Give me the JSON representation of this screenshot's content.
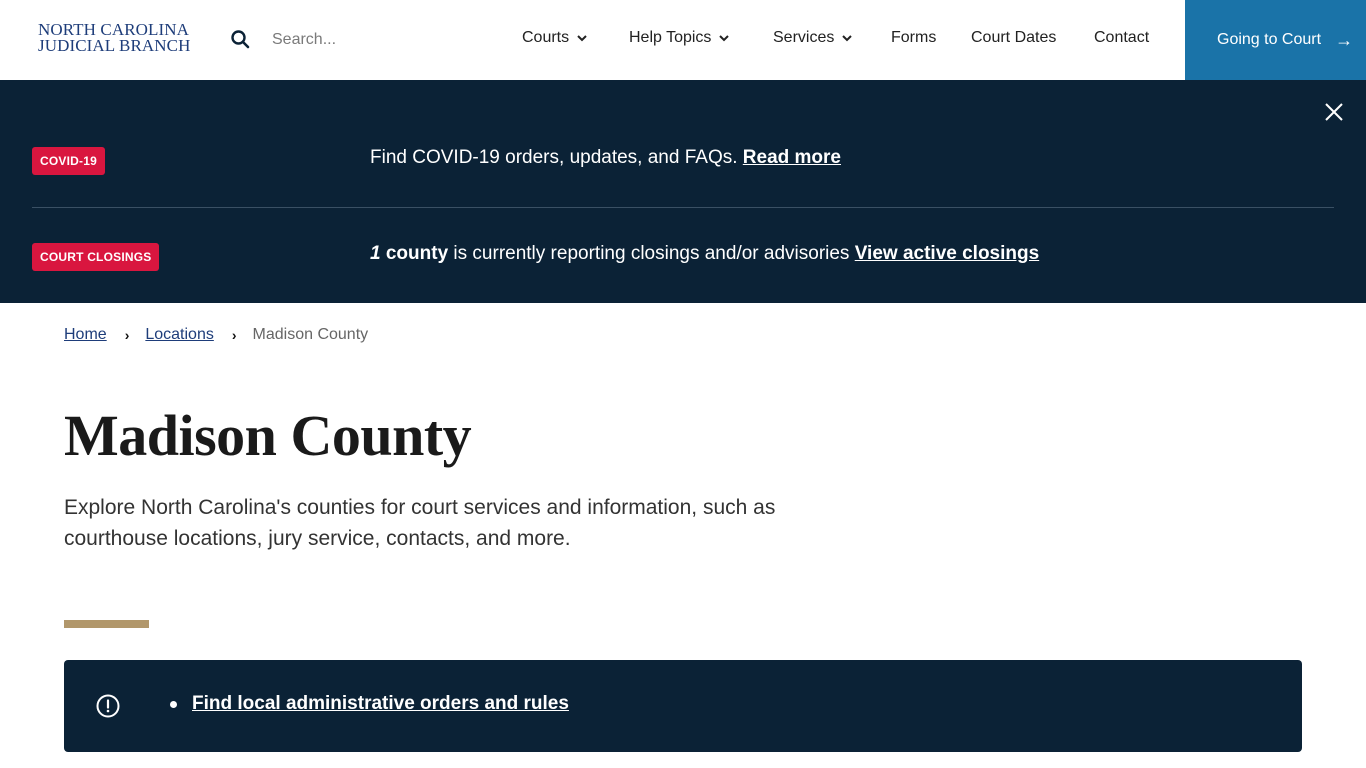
{
  "header": {
    "logo_line1": "NORTH CAROLINA",
    "logo_line2": "JUDICIAL BRANCH",
    "search": {
      "placeholder": "Search...",
      "value": "",
      "icon": "search-icon"
    },
    "nav": [
      {
        "label": "Courts",
        "has_dropdown": true
      },
      {
        "label": "Help Topics",
        "has_dropdown": true
      },
      {
        "label": "Services",
        "has_dropdown": true
      },
      {
        "label": "Forms",
        "has_dropdown": false
      },
      {
        "label": "Court Dates",
        "has_dropdown": false
      },
      {
        "label": "Contact",
        "has_dropdown": false
      }
    ],
    "cta": {
      "label": "Going to Court",
      "arrow": "→",
      "color": "#1a73a8"
    }
  },
  "alerts": {
    "background": "#0b2236",
    "items": [
      {
        "badge": "COVID-19",
        "text": "Find COVID-19 orders, updates, and FAQs.",
        "link": "Read more"
      },
      {
        "badge": "COURT CLOSINGS",
        "count": "1",
        "count_label": "county",
        "text": "is currently reporting closings and/or advisories",
        "link": "View active closings"
      }
    ],
    "badge_color": "#d9163f"
  },
  "breadcrumb": {
    "items": [
      "Home",
      "Locations"
    ],
    "current": "Madison County",
    "separator": "›"
  },
  "page": {
    "title": "Madison County",
    "intro": "Explore North Carolina's counties for court services and information, such as courthouse locations, jury service, contacts, and more.",
    "accent_color": "#b1976b"
  },
  "info_box": {
    "icon": "alert-circle-icon",
    "links": [
      "Find local administrative orders and rules"
    ]
  }
}
